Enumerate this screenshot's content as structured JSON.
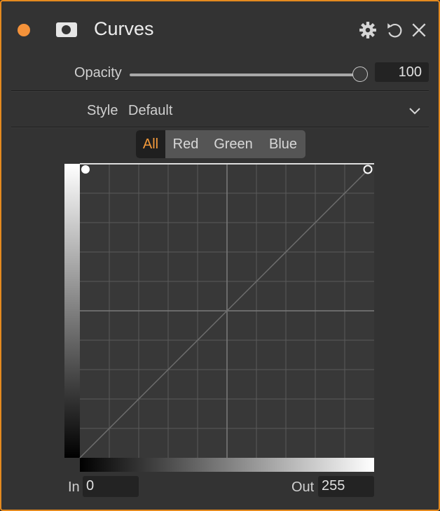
{
  "header": {
    "title": "Curves",
    "accent_color": "#f4923a",
    "icons": [
      "status-dot-icon",
      "mask-icon",
      "gear-icon",
      "undo-icon",
      "close-icon"
    ]
  },
  "opacity": {
    "label": "Opacity",
    "value": "100",
    "level": 1.0
  },
  "style": {
    "label": "Style",
    "value": "Default"
  },
  "channels": {
    "tabs": [
      "All",
      "Red",
      "Green",
      "Blue"
    ],
    "active": "All",
    "active_color": "#f39a3b"
  },
  "io": {
    "in_label": "In",
    "in_value": "0",
    "out_label": "Out",
    "out_value": "255"
  }
}
